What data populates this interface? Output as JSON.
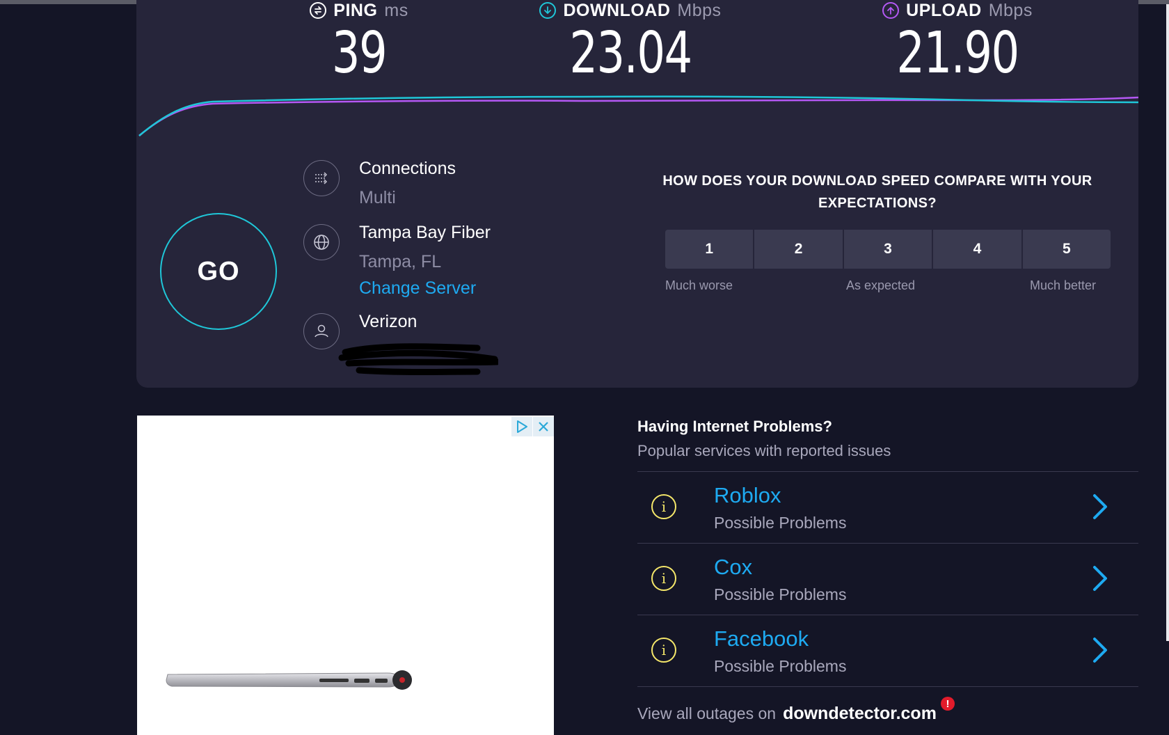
{
  "metrics": {
    "ping": {
      "label": "PING",
      "unit": "ms",
      "value": "39",
      "icon": "ping-icon",
      "color": "#ffffff"
    },
    "download": {
      "label": "DOWNLOAD",
      "unit": "Mbps",
      "value": "23.04",
      "icon": "download-arrow-icon",
      "color": "#1fc7d8"
    },
    "upload": {
      "label": "UPLOAD",
      "unit": "Mbps",
      "value": "21.90",
      "icon": "upload-arrow-icon",
      "color": "#b458f4"
    }
  },
  "go_button": {
    "label": "GO"
  },
  "connection_info": {
    "connections": {
      "title": "Connections",
      "value": "Multi"
    },
    "server": {
      "name": "Tampa Bay Fiber",
      "location": "Tampa, FL",
      "change_label": "Change Server"
    },
    "provider": {
      "name": "Verizon"
    }
  },
  "survey": {
    "question": "HOW DOES YOUR DOWNLOAD SPEED COMPARE WITH YOUR EXPECTATIONS?",
    "ratings": [
      "1",
      "2",
      "3",
      "4",
      "5"
    ],
    "labels": {
      "low": "Much worse",
      "mid": "As expected",
      "high": "Much better"
    }
  },
  "outages": {
    "title": "Having Internet Problems?",
    "subtitle": "Popular services with reported issues",
    "items": [
      {
        "name": "Roblox",
        "status": "Possible Problems"
      },
      {
        "name": "Cox",
        "status": "Possible Problems"
      },
      {
        "name": "Facebook",
        "status": "Possible Problems"
      }
    ],
    "footer_text": "View all outages on",
    "footer_link": "downdetector.com"
  },
  "colors": {
    "accent": "#1eaaf1",
    "download": "#1fc7d8",
    "upload": "#b458f4",
    "warning": "#f5e76a"
  }
}
